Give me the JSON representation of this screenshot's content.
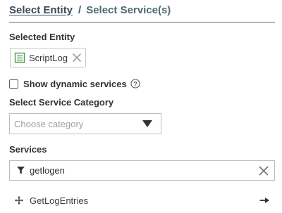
{
  "breadcrumb": {
    "step1": "Select Entity",
    "separator": "/",
    "step2": "Select Service(s)"
  },
  "selected_entity": {
    "label": "Selected Entity",
    "chip_text": "ScriptLog",
    "chip_icon": "document-icon",
    "remove_icon": "close-icon"
  },
  "dynamic_services": {
    "label": "Show dynamic services",
    "checked": false,
    "help_icon": "help-icon"
  },
  "service_category": {
    "label": "Select Service Category",
    "placeholder": "Choose category",
    "arrow_icon": "caret-down-icon"
  },
  "services": {
    "label": "Services",
    "filter_value": "getlogen",
    "filter_icon": "filter-icon",
    "clear_icon": "close-icon",
    "results": [
      {
        "name": "GetLogEntries",
        "drag_icon": "move-icon",
        "action_icon": "arrow-right-icon"
      }
    ]
  },
  "colors": {
    "heading": "#3d4a56",
    "accent_green": "#4a9a4a",
    "border": "#b9bec3",
    "placeholder": "#9aa1a7"
  }
}
